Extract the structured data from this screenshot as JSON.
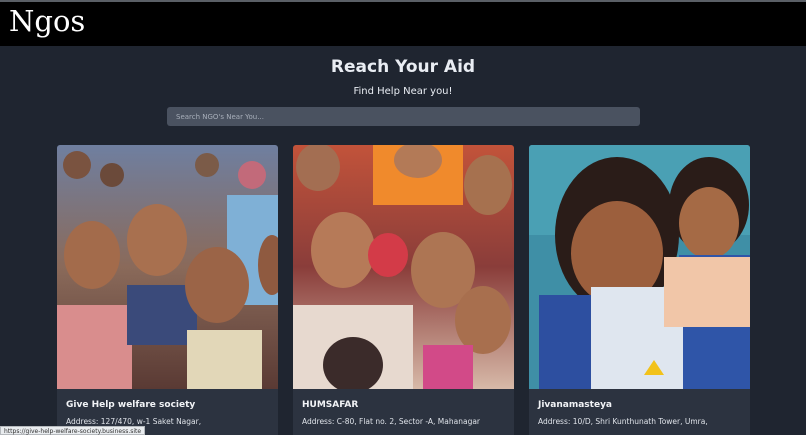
{
  "navbar": {
    "brand": "Ngos"
  },
  "hero": {
    "title": "Reach Your Aid",
    "subtitle": "Find Help Near you!"
  },
  "search": {
    "placeholder": "Search NGO's Near You..."
  },
  "cards": [
    {
      "title": "Give Help welfare society",
      "address": "Address: 127/470, w-1 Saket Nagar,"
    },
    {
      "title": "HUMSAFAR",
      "address": "Address: C-80, Flat no. 2, Sector -A, Mahanagar"
    },
    {
      "title": "Jivanamasteya",
      "address": "Address: 10/D, Shri Kunthunath Tower, Umra,"
    }
  ],
  "status_bar": {
    "url": "https://give-help-welfare-society.business.site"
  }
}
